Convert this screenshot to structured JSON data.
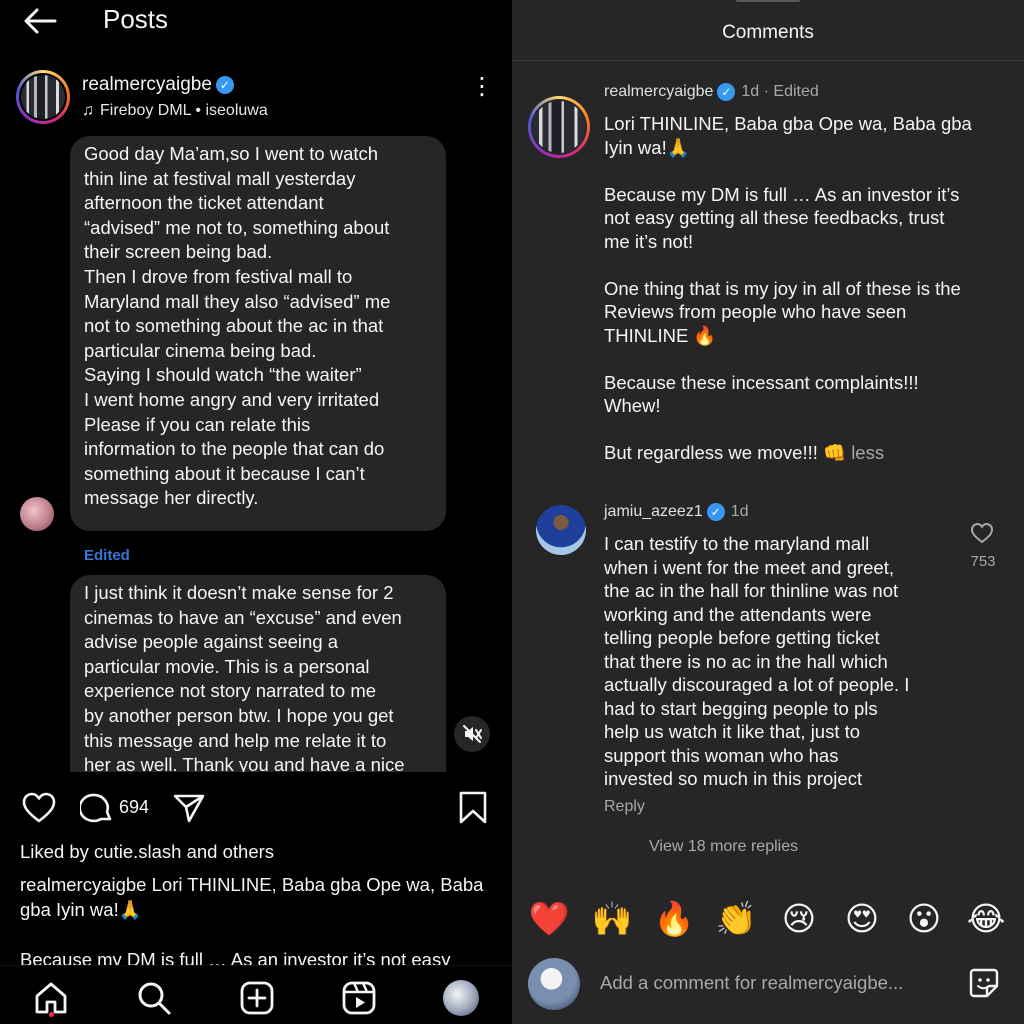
{
  "left": {
    "title": "Posts",
    "post": {
      "username": "realmercyaigbe",
      "verified_mark": "✓",
      "music": "Fireboy DML • iseoluwa",
      "more": "⋮"
    },
    "messages": [
      {
        "text": "Good day Ma’am,so I went to watch\nthin line at festival mall yesterday\nafternoon the ticket attendant\n“advised” me not to, something about\ntheir screen being bad.\nThen I drove from festival mall to\nMaryland mall they also “advised” me\nnot to something about the ac in that\nparticular cinema being bad.\nSaying I should watch “the waiter”\nI went home angry and very irritated\nPlease if you can relate this\ninformation to the people that can do\nsomething about it because I can’t\nmessage her directly."
      },
      {
        "text": "I just think it doesn’t make sense for 2\ncinemas to have an “excuse” and even\nadvise people against seeing a\nparticular movie. This is a personal\nexperience not story narrated to me\nby another person btw. I hope you get\nthis message and help me relate it to\nher as well. Thank you and have a nice"
      }
    ],
    "edited_label": "Edited",
    "comment_count": "694",
    "likes_line": "Liked by cutie.slash and others",
    "caption": "realmercyaigbe Lori THINLINE, Baba gba Ope wa, Baba gba Iyin wa!🙏",
    "caption_continued": "Because my DM is full … As an investor it’s not easy"
  },
  "right": {
    "title": "Comments",
    "comments": [
      {
        "username": "realmercyaigbe",
        "verified_mark": "✓",
        "meta": "1d · Edited",
        "text": "Lori THINLINE, Baba gba Ope wa, Baba gba\nIyin wa!🙏\n\nBecause my DM is full … As an investor it’s\nnot easy getting all these feedbacks, trust\nme it’s not!\n\nOne thing that is my joy in all of these is the\nReviews from people who have seen\nTHINLINE 🔥\n\n Because these incessant complaints!!!\nWhew!\n\nBut regardless we move!!! 👊 ",
        "less": "less"
      },
      {
        "username": "jamiu_azeez1",
        "verified_mark": "✓",
        "meta": "1d",
        "text": "I can testify to the maryland mall\nwhen i went for the meet and greet,\nthe ac in the hall for thinline was not\nworking and the attendants were\ntelling people before getting ticket\nthat there is no ac in the hall which\nactually discouraged a lot of people. I\nhad to start begging people to pls\nhelp us watch it like that, just to\nsupport this woman who has\ninvested so much in this project",
        "like_count": "753",
        "reply": "Reply",
        "view_replies": "View 18 more replies"
      }
    ],
    "emojis": [
      "❤️",
      "🙌",
      "🔥",
      "👏",
      "😢",
      "😍",
      "😮",
      "😂"
    ],
    "composer_placeholder": "Add a comment for realmercyaigbe..."
  },
  "icons": {
    "back": "arrow-left-icon",
    "heart": "heart-icon",
    "comment": "comment-bubble-icon",
    "share": "paper-plane-icon",
    "save": "bookmark-icon",
    "mute": "speaker-muted-icon",
    "home": "home-icon",
    "search": "search-icon",
    "add": "add-square-icon",
    "reels": "reels-icon",
    "sticker": "sticker-icon"
  },
  "colors": {
    "background_left": "#000000",
    "background_right": "#262626",
    "bubble": "#262626",
    "verified": "#3897f0",
    "edited": "#3a76d6",
    "secondary_text": "#a8a8a8",
    "notification_dot": "#ff3040"
  }
}
